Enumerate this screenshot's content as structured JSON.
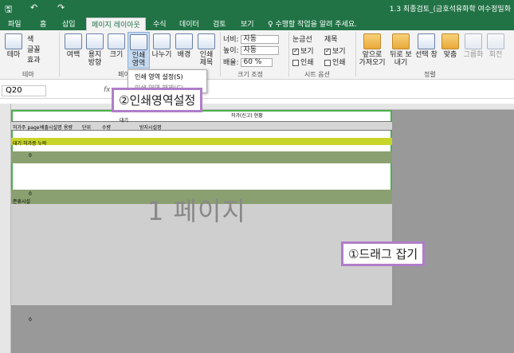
{
  "window": {
    "title": "1.3 최종검토_(금호석유화학 여수정밀화"
  },
  "quick_access": {
    "save": "🖫",
    "undo": "↶",
    "redo": "↷"
  },
  "tabs": [
    {
      "label": "파일"
    },
    {
      "label": "홈"
    },
    {
      "label": "삽입"
    },
    {
      "label": "페이지 레이아웃"
    },
    {
      "label": "수식"
    },
    {
      "label": "데이터"
    },
    {
      "label": "검토"
    },
    {
      "label": "보기"
    }
  ],
  "tell_me": "♀ 수행할 작업을 알려 주세요.",
  "ribbon": {
    "theme": {
      "label": "테마",
      "colors": "색",
      "fonts": "글꼴",
      "effects": "효과",
      "group": "테마"
    },
    "margins": "여백",
    "orientation": "용지 방향",
    "size": "크기",
    "print_area": "인쇄 영역",
    "breaks": "나누기",
    "background": "배경",
    "print_titles": "인쇄 제목",
    "page_setup_group": "페이",
    "width_label": "너비:",
    "width_value": "자동",
    "height_label": "높이:",
    "height_value": "자동",
    "scale_label": "배율:",
    "scale_value": "60 %",
    "scale_group": "크기 조정",
    "gridlines": "눈금선",
    "headings": "제목",
    "view": "보기",
    "print": "인쇄",
    "sheet_options_group": "시트 옵션",
    "bring_forward": "앞으로 가져오기",
    "send_backward": "뒤로 보내기",
    "selection_pane": "선택 창",
    "align": "맞춤",
    "group_btn": "그룹화",
    "rotate": "회전",
    "arrange_group": "정렬"
  },
  "print_area_menu": {
    "set": "인쇄 영역 설정(S)",
    "clear": "인쇄 영역 해제(C)"
  },
  "formula": {
    "name_box": "Q20",
    "fx": "fx"
  },
  "sheet": {
    "watermark": "1 페이지",
    "r_title": "허가(신고) 현황",
    "r_sub": "대기",
    "hdr1": "허가주 page",
    "hdr2": "배출시설명",
    "hdr3": "용량",
    "hdr4": "단위",
    "hdr5": "수량",
    "hdr6": "방지시설명",
    "yellow_label": "대기 허가증 누락",
    "section2": "존휴시설",
    "zero": "0"
  },
  "callouts": {
    "step2": "②인쇄영역설정",
    "step1": "①드래그 잡기"
  }
}
